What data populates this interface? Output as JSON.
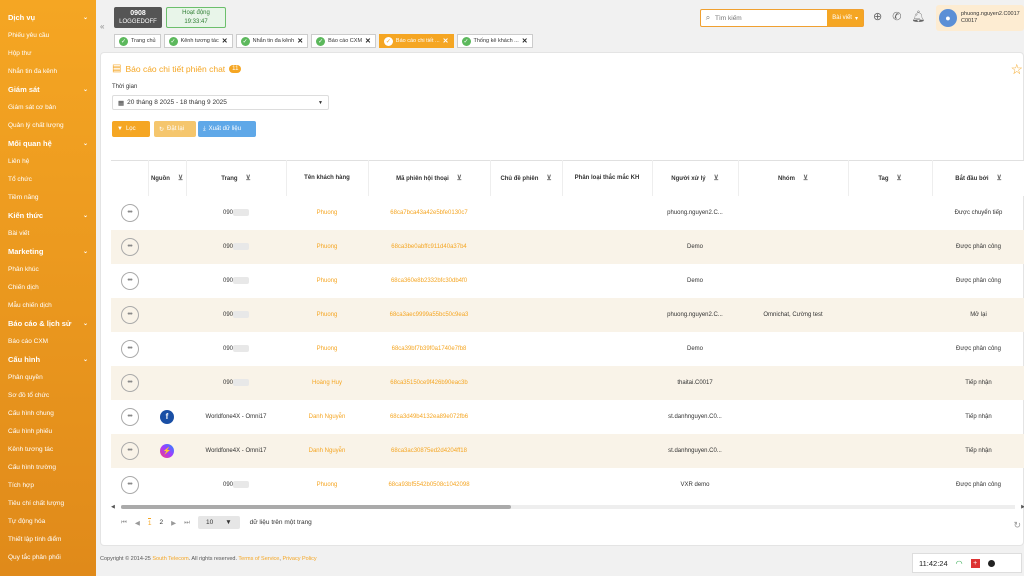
{
  "sidebar": {
    "items": [
      {
        "label": "",
        "section": false,
        "faded": true
      },
      {
        "label": "Dịch vụ",
        "section": true
      },
      {
        "label": "Phiếu yêu cầu",
        "section": false
      },
      {
        "label": "Hộp thư",
        "section": false
      },
      {
        "label": "Nhắn tin đa kênh",
        "section": false
      },
      {
        "label": "Giám sát",
        "section": true
      },
      {
        "label": "Giám sát cơ bản",
        "section": false
      },
      {
        "label": "Quản lý chất lượng",
        "section": false
      },
      {
        "label": "Mối quan hệ",
        "section": true
      },
      {
        "label": "Liên hệ",
        "section": false
      },
      {
        "label": "Tổ chức",
        "section": false
      },
      {
        "label": "Tiềm năng",
        "section": false
      },
      {
        "label": "Kiến thức",
        "section": true
      },
      {
        "label": "Bài viết",
        "section": false
      },
      {
        "label": "Marketing",
        "section": true
      },
      {
        "label": "Phân khúc",
        "section": false
      },
      {
        "label": "Chiến dịch",
        "section": false
      },
      {
        "label": "Mẫu chiến dịch",
        "section": false
      },
      {
        "label": "Báo cáo & lịch sử",
        "section": true
      },
      {
        "label": "Báo cáo CXM",
        "section": false
      },
      {
        "label": "Cấu hình",
        "section": true
      },
      {
        "label": "Phân quyền",
        "section": false
      },
      {
        "label": "Sơ đồ tổ chức",
        "section": false
      },
      {
        "label": "Cấu hình chung",
        "section": false
      },
      {
        "label": "Cấu hình phiếu",
        "section": false
      },
      {
        "label": "Kênh tương tác",
        "section": false
      },
      {
        "label": "Cấu hình trường",
        "section": false
      },
      {
        "label": "Tích hợp",
        "section": false
      },
      {
        "label": "Tiêu chí chất lượng",
        "section": false
      },
      {
        "label": "Tự động hóa",
        "section": false
      },
      {
        "label": "Thiết lập tính điểm",
        "section": false
      },
      {
        "label": "Quy tắc phân phối",
        "section": false
      }
    ]
  },
  "header": {
    "agent_number": "0908",
    "agent_status": "LOGGEDOFF",
    "activity_label": "Hoạt động",
    "activity_time": "19:33:47",
    "search_placeholder": "Tìm kiếm",
    "search_scope": "Bài viết",
    "user_name": "phuong.nguyen2.C0017",
    "user_code": "C0017"
  },
  "tabs": [
    {
      "label": "Trang chủ",
      "active": false,
      "closable": false
    },
    {
      "label": "Kênh tương tác",
      "active": false,
      "closable": true
    },
    {
      "label": "Nhắn tin đa kênh",
      "active": false,
      "closable": true
    },
    {
      "label": "Báo cáo CXM",
      "active": false,
      "closable": true
    },
    {
      "label": "Báo cáo chi tiết ...",
      "active": true,
      "closable": true
    },
    {
      "label": "Thống kê khách ...",
      "active": false,
      "closable": true
    }
  ],
  "page": {
    "title": "Báo cáo chi tiết phiên chat",
    "badge": "11",
    "time_label": "Thời gian",
    "date_range": "20 tháng 8 2025 - 18 tháng 9 2025",
    "filter_btn": "Lọc",
    "reset_btn": "Đặt lại",
    "export_btn": "Xuất dữ liệu"
  },
  "table": {
    "columns": [
      "",
      "Nguồn",
      "Trang",
      "Tên khách hàng",
      "Mã phiên hội thoại",
      "Chủ đề phiên",
      "Phân loại thắc mắc KH",
      "Người xử lý",
      "Nhóm",
      "Tag",
      "Bắt đầu bởi"
    ],
    "rows": [
      {
        "source": "",
        "page": "090",
        "customer": "Phuong",
        "session": "68ca7bca43a42e5bfe0130c7",
        "topic": "",
        "category": "",
        "handler": "phuong.nguyen2.C...",
        "group": "",
        "tag": "",
        "started_by": "Được chuyển tiếp"
      },
      {
        "source": "",
        "page": "090",
        "customer": "Phuong",
        "session": "68ca3be0abffc911d40a37b4",
        "topic": "",
        "category": "",
        "handler": "Demo",
        "group": "",
        "tag": "",
        "started_by": "Được phân công"
      },
      {
        "source": "",
        "page": "090",
        "customer": "Phuong",
        "session": "68ca360e8b2332bfc30db4f0",
        "topic": "",
        "category": "",
        "handler": "Demo",
        "group": "",
        "tag": "",
        "started_by": "Được phân công"
      },
      {
        "source": "",
        "page": "090",
        "customer": "Phuong",
        "session": "68ca3aec9999a55bc50c9ea3",
        "topic": "",
        "category": "",
        "handler": "phuong.nguyen2.C...",
        "group": "Omnichat, Cường test",
        "tag": "",
        "started_by": "Mở lại"
      },
      {
        "source": "",
        "page": "090",
        "customer": "Phuong",
        "session": "68ca39bf7b39f0a1740e7fb8",
        "topic": "",
        "category": "",
        "handler": "Demo",
        "group": "",
        "tag": "",
        "started_by": "Được phân công"
      },
      {
        "source": "",
        "page": "090",
        "customer": "Hoàng Huy",
        "session": "68ca35150ce9f426b90eac3b",
        "topic": "",
        "category": "",
        "handler": "thaitai.C0017",
        "group": "",
        "tag": "",
        "started_by": "Tiếp nhận"
      },
      {
        "source": "facebook",
        "page": "Worldfone4X - Omni17",
        "customer": "Danh Nguyễn",
        "session": "68ca3d49b4132ea89e072fb6",
        "topic": "",
        "category": "",
        "handler": "st.danhnguyen.C0...",
        "group": "",
        "tag": "",
        "started_by": "Tiếp nhận"
      },
      {
        "source": "messenger",
        "page": "Worldfone4X - Omni17",
        "customer": "Danh Nguyễn",
        "session": "68ca3ac30875ed2d4204ff18",
        "topic": "",
        "category": "",
        "handler": "st.danhnguyen.C0...",
        "group": "",
        "tag": "",
        "started_by": "Tiếp nhận"
      },
      {
        "source": "",
        "page": "090",
        "customer": "Phuong",
        "session": "68ca93bf5542b0508c1042098",
        "topic": "",
        "category": "",
        "handler": "VXR demo",
        "group": "",
        "tag": "",
        "started_by": "Được phân công"
      }
    ]
  },
  "pager": {
    "first": "⏮",
    "prev": "◀",
    "page1": "1",
    "page2": "2",
    "next": "▶",
    "last": "⏭",
    "size": "10",
    "size_label": "dữ liệu trên một trang"
  },
  "footer": {
    "copyright": "Copyright © 2014-25 ",
    "company": "South Telecom",
    "rights": ". All rights reserved. ",
    "terms": "Terms of Service",
    "sep": ", ",
    "privacy": "Privacy Policy",
    "clock": "11:42:24"
  },
  "colors": {
    "accent": "#f5a623",
    "sidebar": "#e08a1a",
    "link": "#f5a623",
    "row_alt": "#f9f3e8"
  }
}
